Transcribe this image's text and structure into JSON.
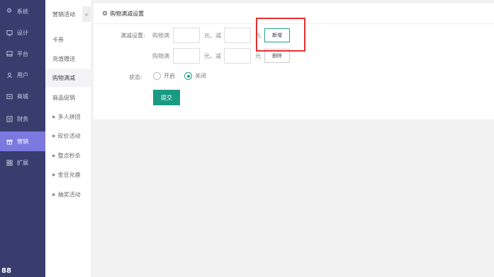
{
  "sidebar": {
    "items": [
      {
        "label": "系统",
        "icon": "gear-icon"
      },
      {
        "label": "设计",
        "icon": "monitor-icon"
      },
      {
        "label": "平台",
        "icon": "platform-icon"
      },
      {
        "label": "用户",
        "icon": "user-icon"
      },
      {
        "label": "商城",
        "icon": "shop-icon"
      },
      {
        "label": "财务",
        "icon": "finance-icon"
      },
      {
        "label": "营销",
        "icon": "gift-icon"
      },
      {
        "label": "扩展",
        "icon": "grid-icon"
      }
    ],
    "active_index": 6,
    "active_color": "#7b78e0",
    "background_color": "#393d6e",
    "bottom_logo": "88"
  },
  "submenu": {
    "header": "营销活动",
    "collapse_glyph": "«",
    "items": [
      {
        "label": "卡券",
        "has_arrow": false
      },
      {
        "label": "充值赠送",
        "has_arrow": false
      },
      {
        "label": "购物满减",
        "has_arrow": false
      },
      {
        "label": "商品促销",
        "has_arrow": false
      },
      {
        "label": "多人拼团",
        "has_arrow": true
      },
      {
        "label": "砍价活动",
        "has_arrow": true
      },
      {
        "label": "整点秒杀",
        "has_arrow": true
      },
      {
        "label": "金豆兑换",
        "has_arrow": true
      },
      {
        "label": "抽奖活动",
        "has_arrow": true
      }
    ],
    "active_index": 2
  },
  "panel": {
    "title": "购物满减设置",
    "rule_label": "满减设置:",
    "rules": [
      {
        "prefix": "购物满",
        "mid": "元，减",
        "suffix": "元",
        "button": "新增"
      },
      {
        "prefix": "购物满",
        "mid": "元，减",
        "suffix": "元",
        "button": "删除"
      }
    ],
    "status_label": "状态:",
    "status_options": [
      "开启",
      "关闭"
    ],
    "status_selected": "关闭",
    "submit_label": "提交"
  },
  "colors": {
    "primary": "#199a83",
    "highlight": "#e53030"
  }
}
